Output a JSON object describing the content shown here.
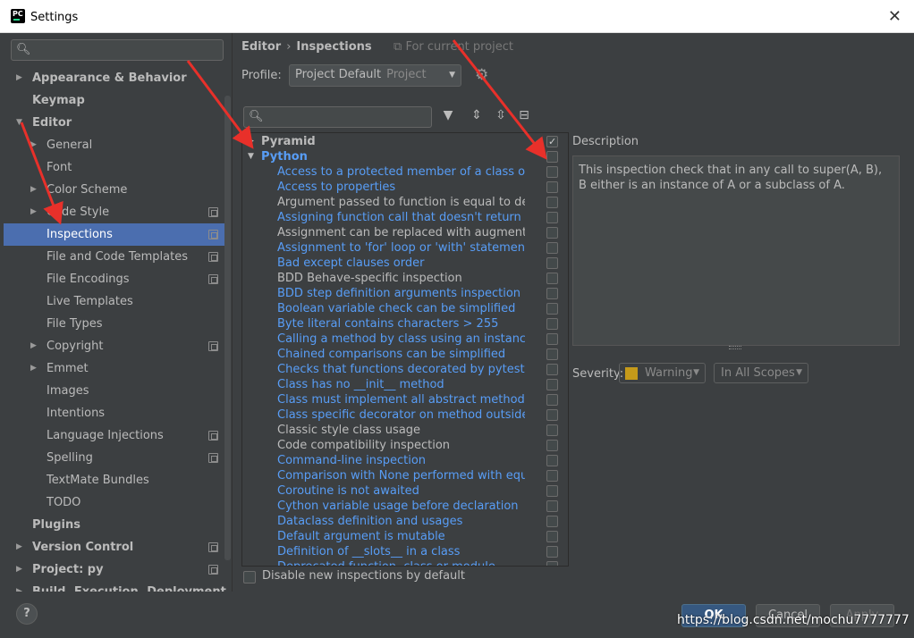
{
  "window": {
    "title": "Settings",
    "icon_text": "PC"
  },
  "sidebar": {
    "items": [
      {
        "label": "Appearance & Behavior",
        "indent": 0,
        "bold": true,
        "expander": "collapsed",
        "project": false
      },
      {
        "label": "Keymap",
        "indent": 0,
        "bold": true,
        "expander": "none",
        "project": false
      },
      {
        "label": "Editor",
        "indent": 0,
        "bold": true,
        "expander": "expanded",
        "project": false
      },
      {
        "label": "General",
        "indent": 1,
        "bold": false,
        "expander": "collapsed",
        "project": false
      },
      {
        "label": "Font",
        "indent": 1,
        "bold": false,
        "expander": "none",
        "project": false
      },
      {
        "label": "Color Scheme",
        "indent": 1,
        "bold": false,
        "expander": "collapsed",
        "project": false
      },
      {
        "label": "Code Style",
        "indent": 1,
        "bold": false,
        "expander": "collapsed",
        "project": true
      },
      {
        "label": "Inspections",
        "indent": 1,
        "bold": false,
        "expander": "none",
        "project": true,
        "selected": true
      },
      {
        "label": "File and Code Templates",
        "indent": 1,
        "bold": false,
        "expander": "none",
        "project": true
      },
      {
        "label": "File Encodings",
        "indent": 1,
        "bold": false,
        "expander": "none",
        "project": true
      },
      {
        "label": "Live Templates",
        "indent": 1,
        "bold": false,
        "expander": "none",
        "project": false
      },
      {
        "label": "File Types",
        "indent": 1,
        "bold": false,
        "expander": "none",
        "project": false
      },
      {
        "label": "Copyright",
        "indent": 1,
        "bold": false,
        "expander": "collapsed",
        "project": true
      },
      {
        "label": "Emmet",
        "indent": 1,
        "bold": false,
        "expander": "collapsed",
        "project": false
      },
      {
        "label": "Images",
        "indent": 1,
        "bold": false,
        "expander": "none",
        "project": false
      },
      {
        "label": "Intentions",
        "indent": 1,
        "bold": false,
        "expander": "none",
        "project": false
      },
      {
        "label": "Language Injections",
        "indent": 1,
        "bold": false,
        "expander": "none",
        "project": true
      },
      {
        "label": "Spelling",
        "indent": 1,
        "bold": false,
        "expander": "none",
        "project": true
      },
      {
        "label": "TextMate Bundles",
        "indent": 1,
        "bold": false,
        "expander": "none",
        "project": false
      },
      {
        "label": "TODO",
        "indent": 1,
        "bold": false,
        "expander": "none",
        "project": false
      },
      {
        "label": "Plugins",
        "indent": 0,
        "bold": true,
        "expander": "none",
        "project": false
      },
      {
        "label": "Version Control",
        "indent": 0,
        "bold": true,
        "expander": "collapsed",
        "project": true
      },
      {
        "label": "Project: py",
        "indent": 0,
        "bold": true,
        "expander": "collapsed",
        "project": true
      },
      {
        "label": "Build, Execution, Deployment",
        "indent": 0,
        "bold": true,
        "expander": "collapsed",
        "project": false
      }
    ]
  },
  "header": {
    "crumb_1": "Editor",
    "crumb_sep": "›",
    "crumb_2": "Inspections",
    "for_project": "For current project"
  },
  "profile": {
    "label": "Profile:",
    "value": "Project Default",
    "value_muted": "Project"
  },
  "inspections": {
    "groups": [
      {
        "label": "Pyramid",
        "expanded": false,
        "checked": true,
        "blue": false
      },
      {
        "label": "Python",
        "expanded": true,
        "checked": false,
        "blue": true
      }
    ],
    "items": [
      {
        "label": "Access to a protected member of a class or a m",
        "link": true
      },
      {
        "label": "Access to properties",
        "link": true
      },
      {
        "label": "Argument passed to function is equal to defaul",
        "link": false
      },
      {
        "label": "Assigning function call that doesn't return anything",
        "link": true
      },
      {
        "label": "Assignment can be replaced with augmented as",
        "link": false
      },
      {
        "label": "Assignment to 'for' loop or 'with' statement par",
        "link": true
      },
      {
        "label": "Bad except clauses order",
        "link": true
      },
      {
        "label": "BDD Behave-specific inspection",
        "link": false
      },
      {
        "label": "BDD step definition arguments inspection",
        "link": true
      },
      {
        "label": "Boolean variable check can be simplified",
        "link": true
      },
      {
        "label": "Byte literal contains characters > 255",
        "link": true
      },
      {
        "label": "Calling a method by class using an instance of a",
        "link": true
      },
      {
        "label": "Chained comparisons can be simplified",
        "link": true
      },
      {
        "label": "Checks that functions decorated by pytest para",
        "link": true
      },
      {
        "label": "Class has no __init__ method",
        "link": true
      },
      {
        "label": "Class must implement all abstract methods",
        "link": true
      },
      {
        "label": "Class specific decorator on method outside cla",
        "link": true
      },
      {
        "label": "Classic style class usage",
        "link": false
      },
      {
        "label": "Code compatibility inspection",
        "link": false
      },
      {
        "label": "Command-line inspection",
        "link": true
      },
      {
        "label": "Comparison with None performed with equality",
        "link": true
      },
      {
        "label": "Coroutine is not awaited",
        "link": true
      },
      {
        "label": "Cython variable usage before declaration",
        "link": true
      },
      {
        "label": "Dataclass definition and usages",
        "link": true
      },
      {
        "label": "Default argument is mutable",
        "link": true
      },
      {
        "label": "Definition of __slots__ in a class",
        "link": true
      },
      {
        "label": "Deprecated function, class or module",
        "link": true
      }
    ]
  },
  "description": {
    "label": "Description",
    "text": "This inspection check that in any call to super(A, B), B either is an instance of A or a subclass of A."
  },
  "severity": {
    "label": "Severity:",
    "value": "Warning",
    "swatch_color": "#c59a1a",
    "scope": "In All Scopes"
  },
  "disable_new": {
    "label": "Disable new inspections by default",
    "checked": false
  },
  "buttons": {
    "help": "?",
    "ok": "OK",
    "cancel": "Cancel",
    "apply": "Apply"
  },
  "watermark": "https://blog.csdn.net/mochu7777777",
  "colors": {
    "link": "#589df6",
    "selection": "#4b6eaf",
    "annotation_red": "#e8302a"
  }
}
